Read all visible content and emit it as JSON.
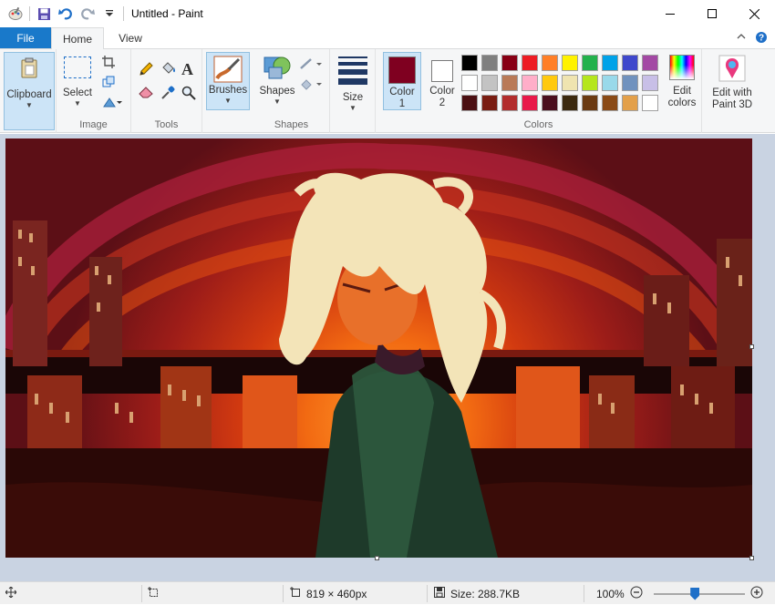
{
  "window": {
    "title": "Untitled - Paint"
  },
  "tabs": {
    "file": "File",
    "home": "Home",
    "view": "View"
  },
  "ribbon": {
    "clipboard": {
      "label": "Clipboard"
    },
    "image": {
      "select_label": "Select",
      "group_label": "Image"
    },
    "tools": {
      "group_label": "Tools"
    },
    "brushes": {
      "label": "Brushes"
    },
    "shapes": {
      "label": "Shapes",
      "group_label": "Shapes"
    },
    "size": {
      "label": "Size"
    },
    "colors": {
      "color1_line1": "Color",
      "color1_line2": "1",
      "color2_line1": "Color",
      "color2_line2": "2",
      "group_label": "Colors",
      "edit_line1": "Edit",
      "edit_line2": "colors",
      "color1_value": "#7f0020",
      "color2_value": "#ffffff",
      "palette_row1": [
        "#000000",
        "#7f7f7f",
        "#880015",
        "#ed1c24",
        "#ff7f27",
        "#fff200",
        "#22b14c",
        "#00a2e8",
        "#3f48cc",
        "#a349a4"
      ],
      "palette_row2": [
        "#ffffff",
        "#c3c3c3",
        "#b97a57",
        "#ffaec9",
        "#ffc90e",
        "#efe4b0",
        "#b5e61d",
        "#99d9ea",
        "#7092be",
        "#c8bfe7"
      ],
      "palette_row3": [
        "#4b0f12",
        "#7a1d12",
        "#b22d2d",
        "#e8194a",
        "#4a0e1e",
        "#3c2a10",
        "#6b3a12",
        "#8a4a16",
        "#e3a04a",
        "#ffffff"
      ]
    },
    "paint3d": {
      "line1": "Edit with",
      "line2": "Paint 3D"
    }
  },
  "status": {
    "dimensions": "819 × 460px",
    "size": "Size: 288.7KB",
    "zoom": "100%",
    "zoom_level": 1.0
  }
}
